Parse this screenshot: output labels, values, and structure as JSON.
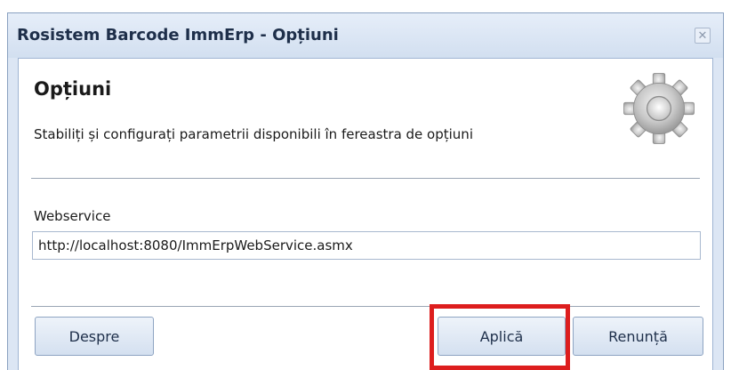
{
  "window": {
    "title": "Rosistem Barcode ImmErp - Opțiuni",
    "close_icon": "close-icon"
  },
  "header": {
    "heading": "Opțiuni",
    "description": "Stabiliți și configurați parametrii disponibili în fereastra de opțiuni",
    "icon": "gear-icon"
  },
  "webservice": {
    "label": "Webservice",
    "value": "http://localhost:8080/ImmErpWebService.asmx"
  },
  "buttons": {
    "about": "Despre",
    "apply": "Aplică",
    "cancel": "Renunță"
  },
  "colors": {
    "highlight": "#dd1e1e",
    "window_bg": "#dce6f4"
  }
}
